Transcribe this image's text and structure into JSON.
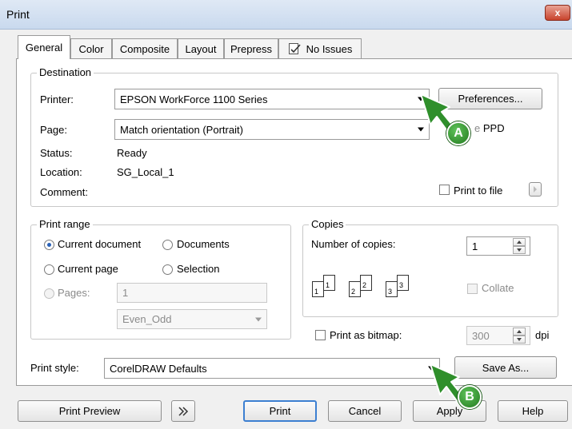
{
  "window": {
    "title": "Print",
    "close_glyph": "x"
  },
  "tabs": [
    {
      "label": "General",
      "active": true
    },
    {
      "label": "Color"
    },
    {
      "label": "Composite"
    },
    {
      "label": "Layout"
    },
    {
      "label": "Prepress"
    },
    {
      "label": "No Issues",
      "icon": "check-document-icon"
    }
  ],
  "destination": {
    "legend": "Destination",
    "printer_label": "Printer:",
    "printer_value": "EPSON WorkForce 1100 Series",
    "preferences_button": "Preferences...",
    "page_label": "Page:",
    "page_value": "Match orientation (Portrait)",
    "ppd_text": "PPD",
    "use_ppd_text_fragment": "e",
    "status_label": "Status:",
    "status_value": "Ready",
    "location_label": "Location:",
    "location_value": "SG_Local_1",
    "comment_label": "Comment:",
    "print_to_file_label": "Print to file",
    "print_to_file_checked": false
  },
  "print_range": {
    "legend": "Print range",
    "current_document": "Current document",
    "documents": "Documents",
    "current_page": "Current page",
    "selection": "Selection",
    "pages_label": "Pages:",
    "pages_value": "1",
    "even_odd_value": "Even_Odd",
    "selected": "current_document"
  },
  "copies": {
    "legend": "Copies",
    "number_label": "Number of copies:",
    "number_value": "1",
    "collate_label": "Collate",
    "collate_icon_numbers": [
      "1",
      "1",
      "2",
      "2",
      "3",
      "3"
    ]
  },
  "bitmap": {
    "label": "Print as bitmap:",
    "dpi_value": "300",
    "dpi_unit": "dpi",
    "checked": false
  },
  "print_style": {
    "label": "Print style:",
    "value": "CorelDRAW Defaults",
    "save_as_button": "Save As..."
  },
  "footer": {
    "print_preview": "Print Preview",
    "print": "Print",
    "cancel": "Cancel",
    "apply": "Apply",
    "help": "Help"
  },
  "callouts": {
    "a": "A",
    "b": "B"
  },
  "colors": {
    "callout_green": "#2f8f2b",
    "close_red": "#c8432c",
    "radio_accent": "#2a62b8"
  }
}
